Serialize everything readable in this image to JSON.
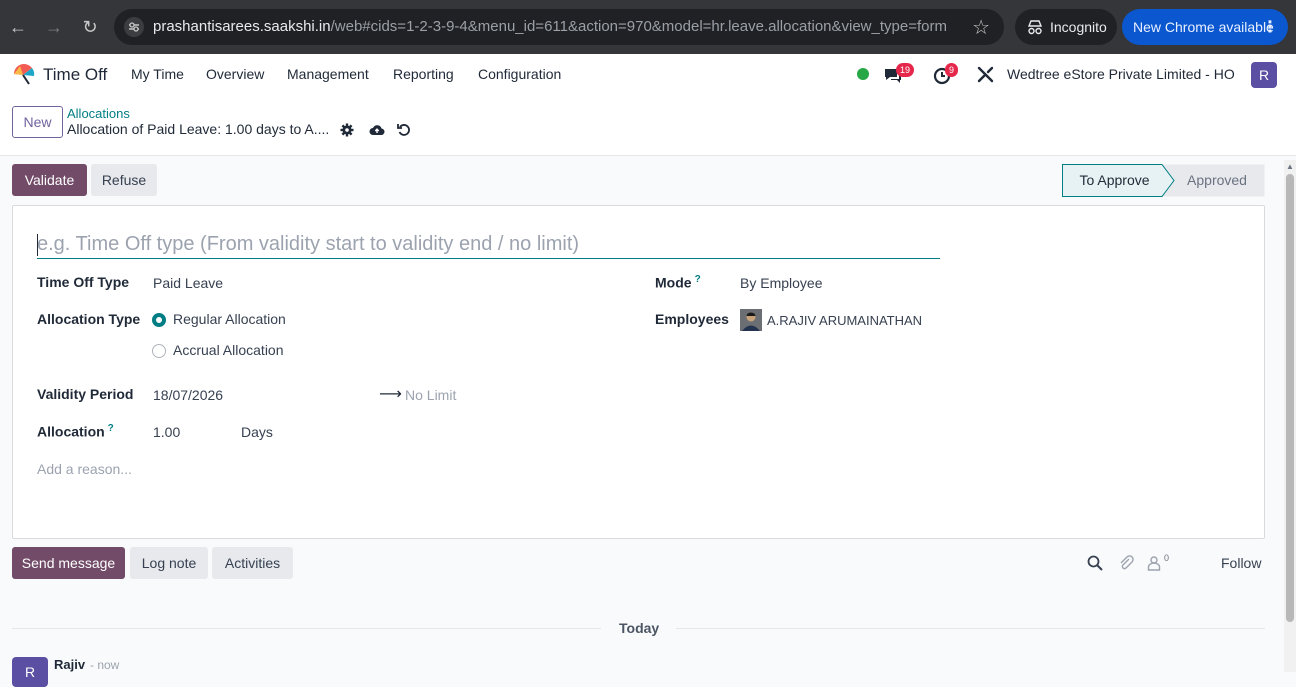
{
  "browser": {
    "url_host": "prashantisarees.saakshi.in",
    "url_path": "/web#cids=1-2-3-9-4&menu_id=611&action=970&model=hr.leave.allocation&view_type=form",
    "incognito_label": "Incognito",
    "update_label": "New Chrome available"
  },
  "navbar": {
    "app_name": "Time Off",
    "menu": [
      "My Time",
      "Overview",
      "Management",
      "Reporting",
      "Configuration"
    ],
    "messages_count": "19",
    "activities_count": "9",
    "company": "Wedtree eStore Private Limited - HO",
    "user_initial": "R"
  },
  "control_panel": {
    "new_label": "New",
    "breadcrumb_parent": "Allocations",
    "breadcrumb_current": "Allocation of Paid Leave: 1.00 days to A...."
  },
  "actions": {
    "validate": "Validate",
    "refuse": "Refuse"
  },
  "statusbar": {
    "stages": [
      "To Approve",
      "Approved"
    ],
    "current": "To Approve"
  },
  "form": {
    "name_placeholder": "e.g. Time Off type (From validity start to validity end / no limit)",
    "time_off_type_label": "Time Off Type",
    "time_off_type_value": "Paid Leave",
    "allocation_type_label": "Allocation Type",
    "allocation_type_options": [
      "Regular Allocation",
      "Accrual Allocation"
    ],
    "allocation_type_selected": "Regular Allocation",
    "validity_label": "Validity Period",
    "validity_start": "18/07/2026",
    "validity_end_placeholder": "No Limit",
    "allocation_label": "Allocation",
    "allocation_value": "1.00",
    "allocation_unit": "Days",
    "reason_placeholder": "Add a reason...",
    "mode_label": "Mode",
    "mode_value": "By Employee",
    "employees_label": "Employees",
    "employee_name": "A.RAJIV ARUMAINATHAN"
  },
  "chatter": {
    "send_message": "Send message",
    "log_note": "Log note",
    "activities": "Activities",
    "followers_count": "0",
    "follow": "Follow",
    "date_separator": "Today",
    "message_author": "Rajiv",
    "message_time": "- now",
    "author_initial": "R"
  },
  "colors": {
    "brand": "#714b67",
    "accent": "#017e84",
    "badge": "#e5274b"
  }
}
